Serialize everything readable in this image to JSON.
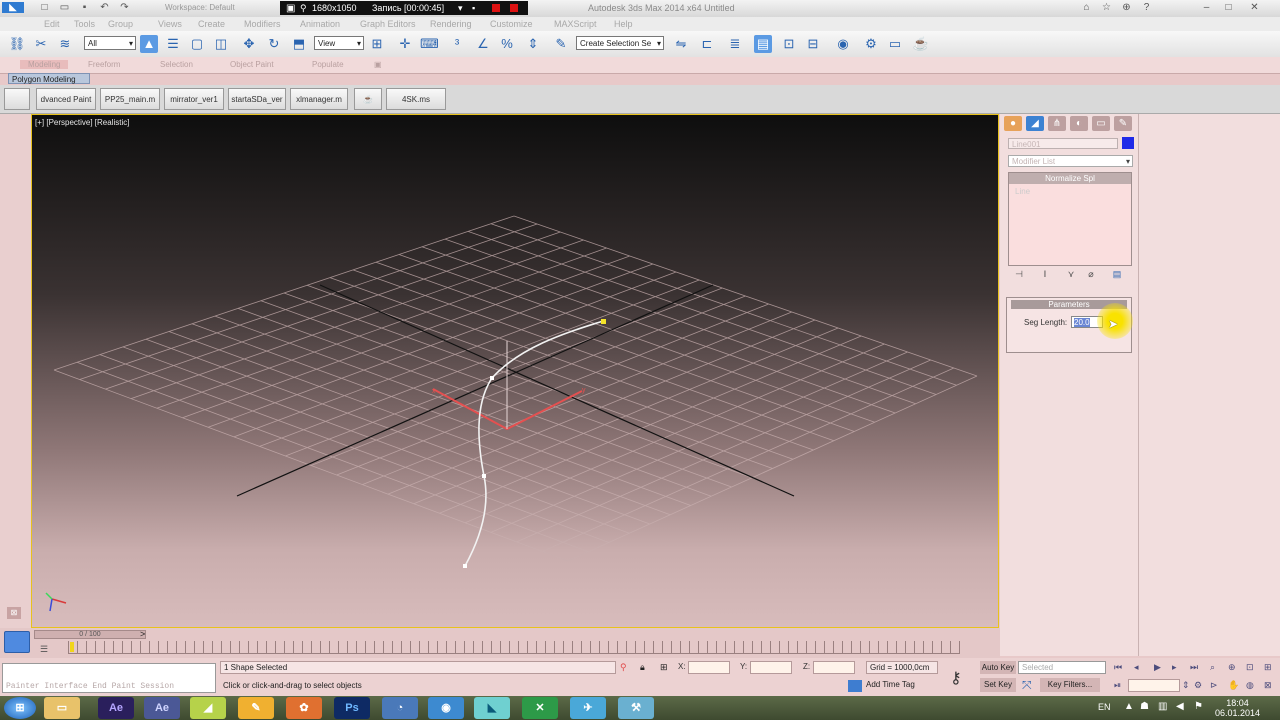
{
  "recorder": {
    "resolution": "1680x1050",
    "recording": "Запись [00:00:45]"
  },
  "window": {
    "title": "Autodesk 3ds Max 2014 x64     Untitled",
    "workspace": "Workspace: Default"
  },
  "menu": [
    "Edit",
    "Tools",
    "Group",
    "Views",
    "Create",
    "Modifiers",
    "Animation",
    "Graph Editors",
    "Rendering",
    "Customize",
    "MAXScript",
    "Help"
  ],
  "toolbar": {
    "undo_combo": "All",
    "ref_coord": "View",
    "selection_set": "Create Selection Se",
    "icons": [
      "link-icon",
      "unlink-icon",
      "bind-icon",
      "selection-filter",
      "select-icon",
      "select-by-name-icon",
      "rect-select-icon",
      "window-crossing-icon",
      "move-icon",
      "rotate-icon",
      "scale-icon"
    ]
  },
  "ribbon": {
    "tabs": [
      "Modeling",
      "Freeform",
      "Selection",
      "Object Paint",
      "Populate"
    ],
    "active_panel": "Polygon Modeling"
  },
  "script_buttons": [
    "dvanced Paint",
    "PP25_main.m",
    "mirrator_ver1",
    "startaSDa_ver",
    "xlmanager.m",
    "",
    "4SK.ms"
  ],
  "viewport": {
    "label": "[+] [Perspective] [Realistic]"
  },
  "command_panel": {
    "tabs": [
      "create-tab",
      "modify-tab",
      "hierarchy-tab",
      "motion-tab",
      "display-tab",
      "utilities-tab"
    ],
    "object_name": "Line001",
    "object_color": "#1f2ae8",
    "modifier_list": "Modifier List",
    "stack": {
      "header": "Normalize Spl",
      "items": [
        "Line"
      ]
    },
    "parameters": {
      "title": "Parameters",
      "seg_length_label": "Seg Length:",
      "seg_length_value": "20.0"
    }
  },
  "timeline": {
    "frame": "0 / 100"
  },
  "status": {
    "maxscript": "Painter Interface End Paint Session",
    "selection": "1 Shape Selected",
    "prompt": "Click or click-and-drag to select objects",
    "x_label": "X:",
    "y_label": "Y:",
    "z_label": "Z:",
    "grid": "Grid = 1000,0cm",
    "add_time_tag": "Add Time Tag",
    "auto_key": "Auto Key",
    "set_key": "Set Key",
    "selected": "Selected",
    "key_filters": "Key Filters..."
  },
  "taskbar": {
    "apps": [
      "Windows",
      "Explorer",
      "Ae",
      "Ae",
      "Illustrator",
      "Tool",
      "Pinwheel",
      "Ps",
      "Folder",
      "Browser",
      "3dsMax",
      "Excel",
      "App",
      "Tool2"
    ],
    "lang": "EN",
    "time": "18:04",
    "date": "06.01.2014"
  }
}
